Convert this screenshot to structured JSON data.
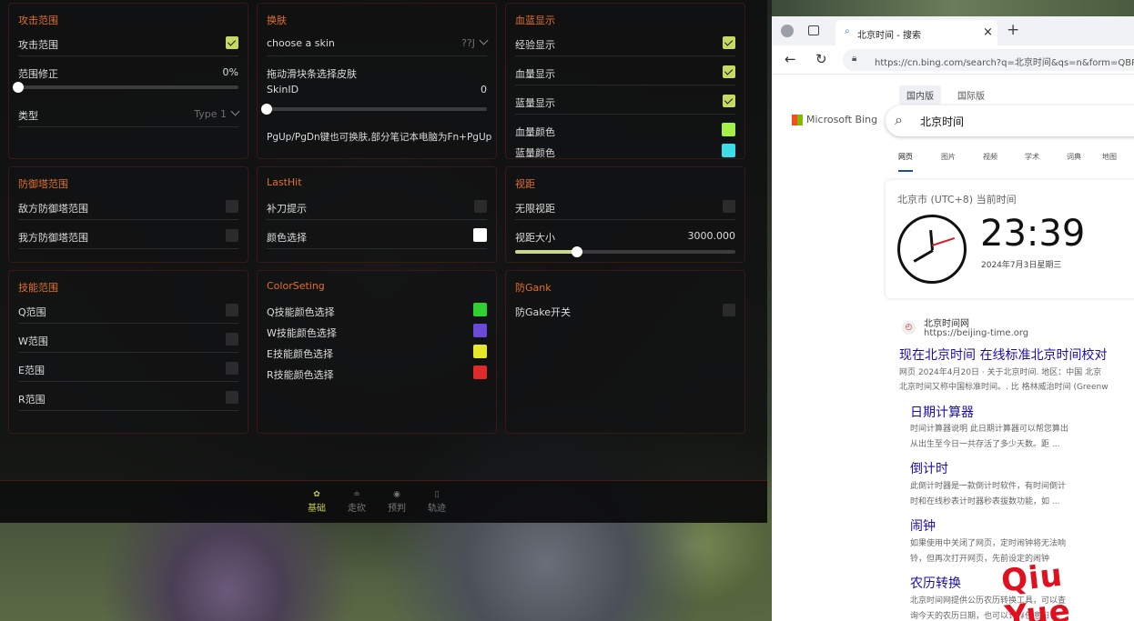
{
  "game_menu": {
    "attack_range": {
      "title": "攻击范围",
      "show_label": "攻击范围",
      "show_checked": true,
      "adjust_label": "范围修正",
      "adjust_value": "0%",
      "adjust_level": 0,
      "type_label": "类型",
      "type_value": "Type 1"
    },
    "skin": {
      "title": "换肤",
      "select_value": "choose a skin",
      "select_suffix": "??J",
      "drag_hint": "拖动滑块条选择皮肤",
      "skin_id_label": "SkinID",
      "skin_id_value": "0",
      "skin_id_level": 0,
      "pg_hint": "PgUp/PgDn键也可换肤,部分笔记本电脑为Fn+PgUp"
    },
    "health_bar": {
      "title": "血蓝显示",
      "exp_label": "经验显示",
      "exp_checked": true,
      "hp_label": "血量显示",
      "hp_checked": true,
      "mp_label": "蓝量显示",
      "mp_checked": true,
      "hp_color_label": "血量颜色",
      "hp_color": "#a6f04a",
      "mp_color_label": "蓝量颜色",
      "mp_color": "#3ddde8"
    },
    "tower_range": {
      "title": "防御塔范围",
      "enemy_label": "敌方防御塔范围",
      "enemy_checked": false,
      "ally_label": "我方防御塔范围",
      "ally_checked": false
    },
    "lasthit": {
      "title": "LastHit",
      "hint_label": "补刀提示",
      "hint_checked": false,
      "color_label": "颜色选择",
      "color": "#ffffff"
    },
    "vision": {
      "title": "视距",
      "unlimited_label": "无限视距",
      "unlimited_checked": false,
      "size_label": "视距大小",
      "size_value": "3000.000",
      "size_level": 0.28
    },
    "skill_range": {
      "title": "技能范围",
      "q_label": "Q范围",
      "w_label": "W范围",
      "e_label": "E范围",
      "r_label": "R范围"
    },
    "color_setting": {
      "title": "ColorSeting",
      "q_label": "Q技能颜色选择",
      "q_color": "#2ed12e",
      "w_label": "W技能颜色选择",
      "w_color": "#6a4ad8",
      "e_label": "E技能颜色选择",
      "e_color": "#e6e62a",
      "r_label": "R技能颜色选择",
      "r_color": "#e02a2a"
    },
    "anti_gank": {
      "title": "防Gank",
      "switch_label": "防Gake开关",
      "switch_checked": false
    },
    "nav": [
      {
        "label": "基础",
        "icon": "gear-icon",
        "active": true
      },
      {
        "label": "走砍",
        "icon": "sword-icon",
        "active": false
      },
      {
        "label": "预判",
        "icon": "eye-icon",
        "active": false
      },
      {
        "label": "轨迹",
        "icon": "file-icon",
        "active": false
      }
    ]
  },
  "browser": {
    "tab_title": "北京时间 - 搜索",
    "tab_close": "×",
    "new_tab": "+",
    "url": "https://cn.bing.com/search?q=北京时间&qs=n&form=QBRE",
    "region_tabs": [
      "国内版",
      "国际版"
    ],
    "logo": "Microsoft Bing",
    "query": "北京时间",
    "scopes": [
      "网页",
      "图片",
      "视频",
      "学术",
      "词典",
      "地图"
    ],
    "time_card": {
      "location": "北京市 (UTC+8) 当前时间",
      "time": "23:39",
      "date": "2024年7月3日星期三"
    },
    "result": {
      "site": "北京时间网",
      "url": "https://beijing-time.org",
      "title": "现在北京时间 在线标准北京时间校对",
      "snippet1": "网页 2024年4月20日 · 关于北京时间. 地区：中国 北京",
      "snippet2": "北京时间又称中国标准时间。. 比 格林威治时间 (Greenw"
    },
    "sublinks": [
      {
        "title": "日期计算器",
        "d1": "时间计算器说明 此日期计算器可以帮您算出",
        "d2": "从出生至今日一共存活了多少天数。距 ..."
      },
      {
        "title": "倒计时",
        "d1": "此倒计时器是一款倒计时软件，有时间倒计",
        "d2": "时和在线秒表计时器秒表拔数功能，如 ..."
      },
      {
        "title": "闹钟",
        "d1": "如果使用中关闭了网页，定时闹钟将无法响",
        "d2": "铃，但再次打开网页，先前设定的闹钟"
      },
      {
        "title": "农历转换",
        "d1": "北京时间网提供公历农历转换工具，可以查",
        "d2": "询今天的农历日期，也可以计算任意阳 ..."
      }
    ]
  },
  "watermark": "Qiu Yue"
}
